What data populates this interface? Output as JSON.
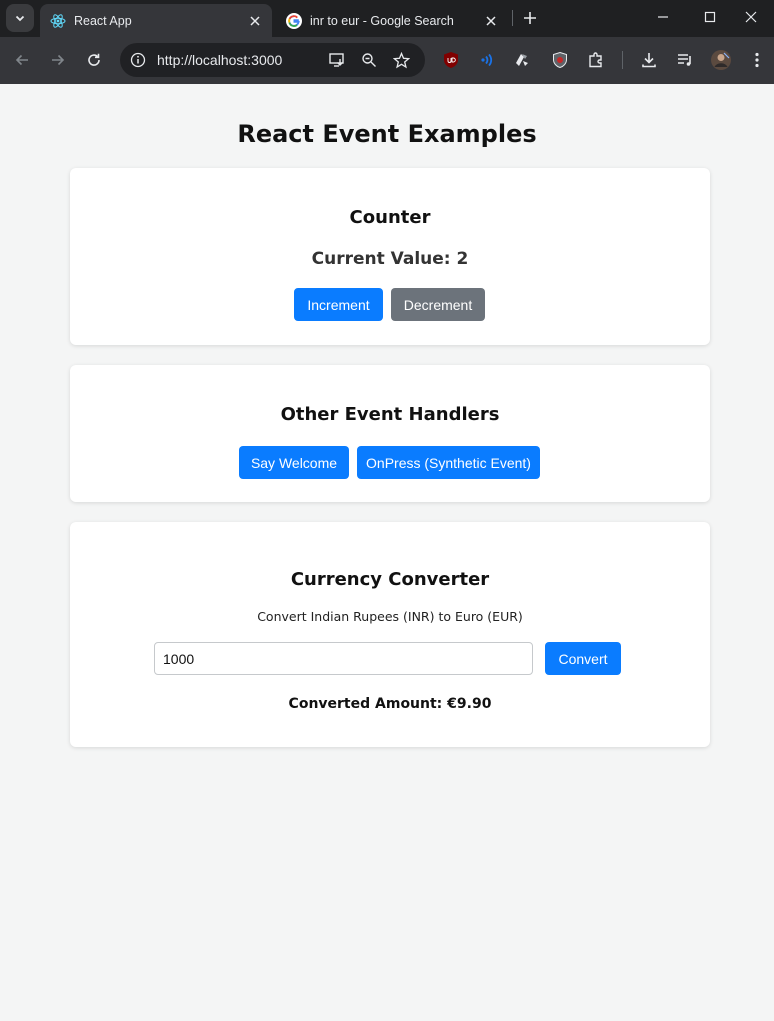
{
  "browser": {
    "tabs": [
      {
        "title": "React App",
        "active": true,
        "icon": "react-icon"
      },
      {
        "title": "inr to eur - Google Search",
        "active": false,
        "icon": "google-icon"
      }
    ],
    "address_bar": {
      "url": "http://localhost:3000"
    },
    "colors": {
      "tabstrip": "#1f2022",
      "toolbar": "#35363a",
      "omnibox": "#202124"
    }
  },
  "page": {
    "title": "React Event Examples",
    "counter": {
      "heading": "Counter",
      "value_label": "Current Value: 2",
      "increment_label": "Increment",
      "decrement_label": "Decrement"
    },
    "other_handlers": {
      "heading": "Other Event Handlers",
      "welcome_label": "Say Welcome",
      "onpress_label": "OnPress (Synthetic Event)"
    },
    "currency": {
      "heading": "Currency Converter",
      "description": "Convert Indian Rupees (INR) to Euro (EUR)",
      "input_value": "1000",
      "convert_label": "Convert",
      "result_label": "Converted Amount: €9.90"
    },
    "colors": {
      "primary": "#0a7cff",
      "secondary": "#6c737b",
      "background": "#f4f5f5"
    }
  }
}
